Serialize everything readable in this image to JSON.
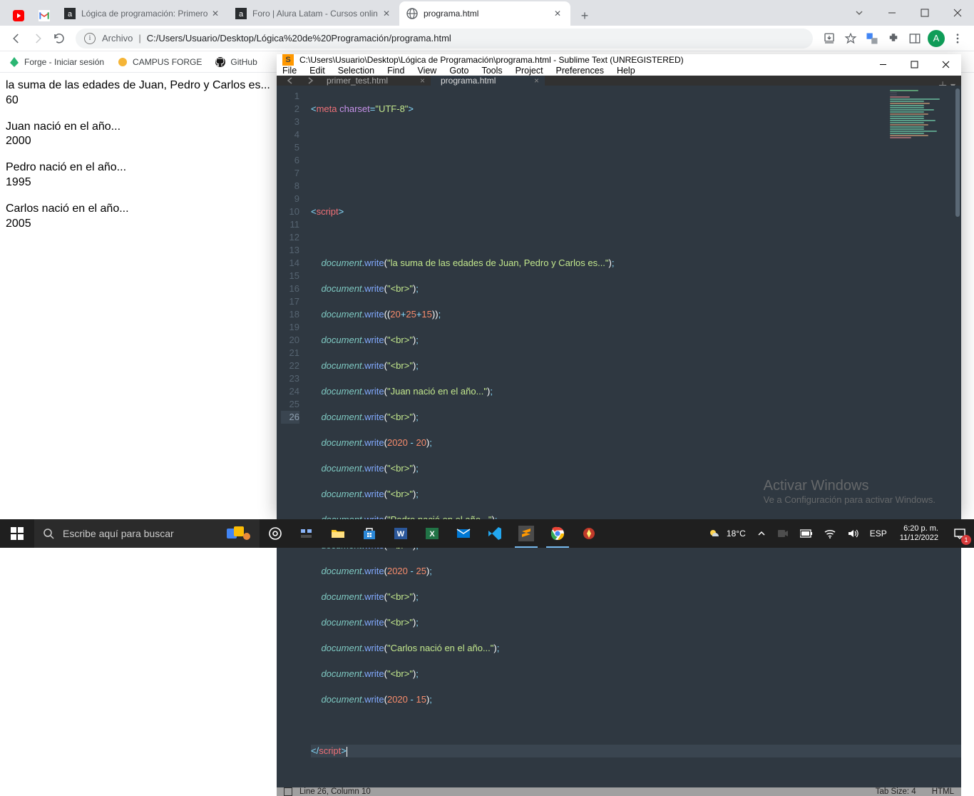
{
  "chrome": {
    "tabs": [
      {
        "label": "",
        "icon": "youtube"
      },
      {
        "label": "",
        "icon": "gmail"
      },
      {
        "label": "Lógica de programación: Primero",
        "icon": "alura"
      },
      {
        "label": "Foro | Alura Latam - Cursos onlin",
        "icon": "alura"
      },
      {
        "label": "programa.html",
        "icon": "globe",
        "active": true
      }
    ],
    "addr": {
      "label": "Archivo",
      "url": "C:/Users/Usuario/Desktop/Lógica%20de%20Programación/programa.html"
    },
    "avatar": "A"
  },
  "bookmarks": [
    {
      "label": "Forge - Iniciar sesión",
      "icon": "forge"
    },
    {
      "label": "CAMPUS FORGE",
      "icon": "campus"
    },
    {
      "label": "GitHub",
      "icon": "github"
    }
  ],
  "page": {
    "l1": "la suma de las edades de Juan, Pedro y Carlos es...",
    "v1": "60",
    "l2": "Juan nació en el año...",
    "v2": "2000",
    "l3": "Pedro nació en el año...",
    "v3": "1995",
    "l4": "Carlos nació en el año...",
    "v4": "2005"
  },
  "sublime": {
    "title": "C:\\Users\\Usuario\\Desktop\\Lógica de Programación\\programa.html - Sublime Text (UNREGISTERED)",
    "menu": [
      "File",
      "Edit",
      "Selection",
      "Find",
      "View",
      "Goto",
      "Tools",
      "Project",
      "Preferences",
      "Help"
    ],
    "tabs": [
      {
        "label": "primer_test.html"
      },
      {
        "label": "programa.html",
        "active": true
      }
    ],
    "status": {
      "pos": "Line 26, Column 10",
      "tabsize": "Tab Size: 4",
      "lang": "HTML"
    },
    "code": {
      "l1_tag": "meta",
      "l1_attr": "charset",
      "l1_val": "\"UTF-8\"",
      "script": "script",
      "obj": "document",
      "fn": "write",
      "s_suma": "\"la suma de las edades de Juan, Pedro y Carlos es...\"",
      "s_br": "\"<br>\"",
      "n20": "20",
      "n25": "25",
      "n15": "15",
      "s_juan": "\"Juan nació en el año...\"",
      "n2020": "2020",
      "s_pedro": "\"Pedro nació en el año...\"",
      "s_carlos": "\"Carlos nació en el año...\""
    }
  },
  "watermark": {
    "t1": "Activar Windows",
    "t2": "Ve a Configuración para activar Windows."
  },
  "taskbar": {
    "search": "Escribe aquí para buscar",
    "temp": "18°C",
    "lang": "ESP",
    "time": "6:20 p. m.",
    "date": "11/12/2022",
    "notif": "1"
  }
}
